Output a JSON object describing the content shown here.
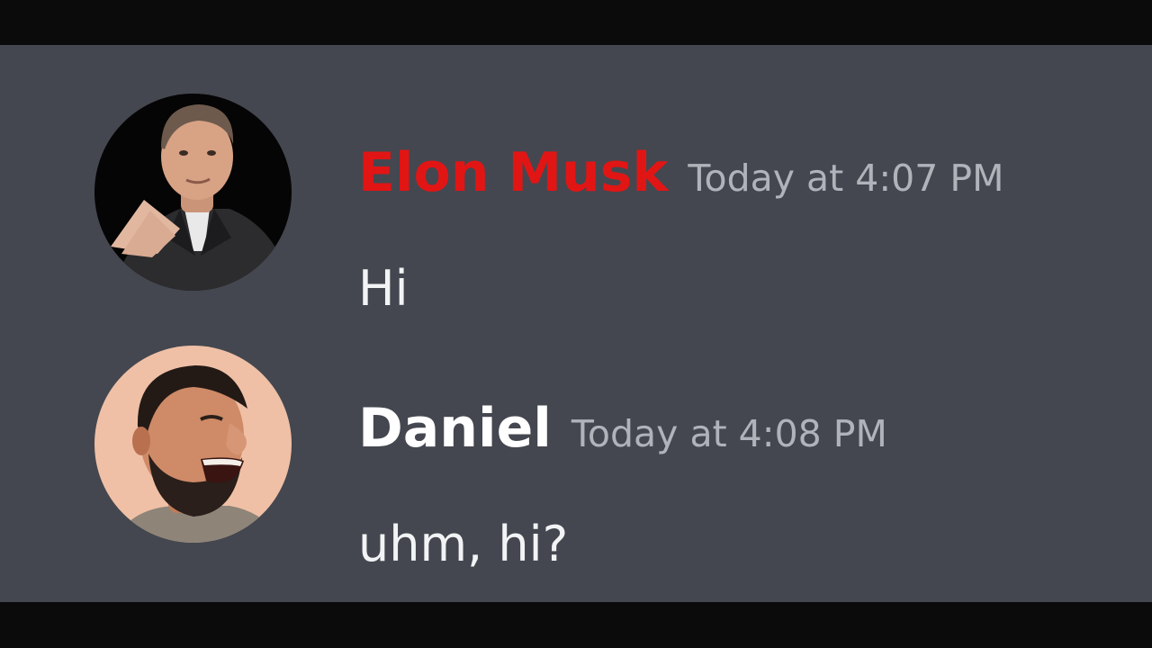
{
  "colors": {
    "chat_background": "#44474f",
    "letterbox": "#0b0b0c",
    "elon_name_color": "#e21515",
    "daniel_name_color": "#ffffff",
    "timestamp_color": "#b0b3ba",
    "message_text_color": "#f2f3f5"
  },
  "messages": [
    {
      "author": "Elon Musk",
      "timestamp": "Today at 4:07 PM",
      "text": "Hi",
      "avatar_icon": "user-avatar-photo"
    },
    {
      "author": "Daniel",
      "timestamp": "Today at 4:08 PM",
      "text": "uhm, hi?",
      "avatar_icon": "user-avatar-photo"
    }
  ]
}
